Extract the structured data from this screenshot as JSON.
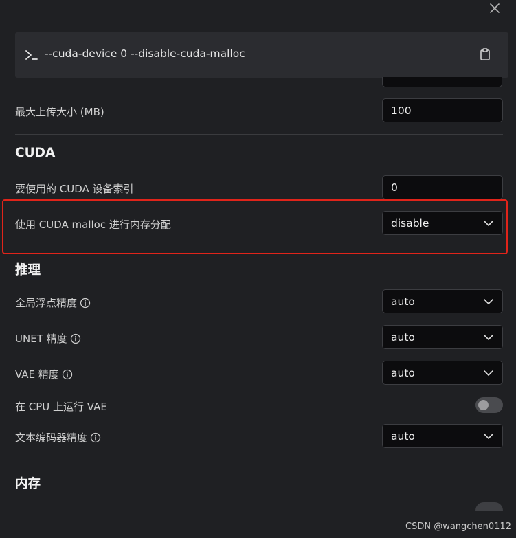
{
  "command": {
    "text": "--cuda-device 0 --disable-cuda-malloc",
    "prompt_icon": "terminal-prompt-icon",
    "copy_icon": "clipboard-icon"
  },
  "settings": {
    "max_upload": {
      "label": "最大上传大小 (MB)",
      "value": "100"
    },
    "cuda": {
      "title": "CUDA",
      "device_index": {
        "label": "要使用的 CUDA 设备索引",
        "value": "0"
      },
      "malloc": {
        "label": "使用 CUDA malloc 进行内存分配",
        "value": "disable"
      }
    },
    "inference": {
      "title": "推理",
      "global_float": {
        "label": "全局浮点精度",
        "value": "auto"
      },
      "unet": {
        "label": "UNET 精度",
        "value": "auto"
      },
      "vae": {
        "label": "VAE 精度",
        "value": "auto"
      },
      "vae_cpu": {
        "label": "在 CPU 上运行 VAE",
        "enabled": false
      },
      "text_encoder": {
        "label": "文本编码器精度",
        "value": "auto"
      }
    },
    "memory": {
      "title": "内存"
    }
  },
  "colors": {
    "highlight": "#e0241a",
    "panel": "#1f2023",
    "input_bg": "#0c0c0e"
  },
  "watermark": "CSDN @wangchen0112"
}
